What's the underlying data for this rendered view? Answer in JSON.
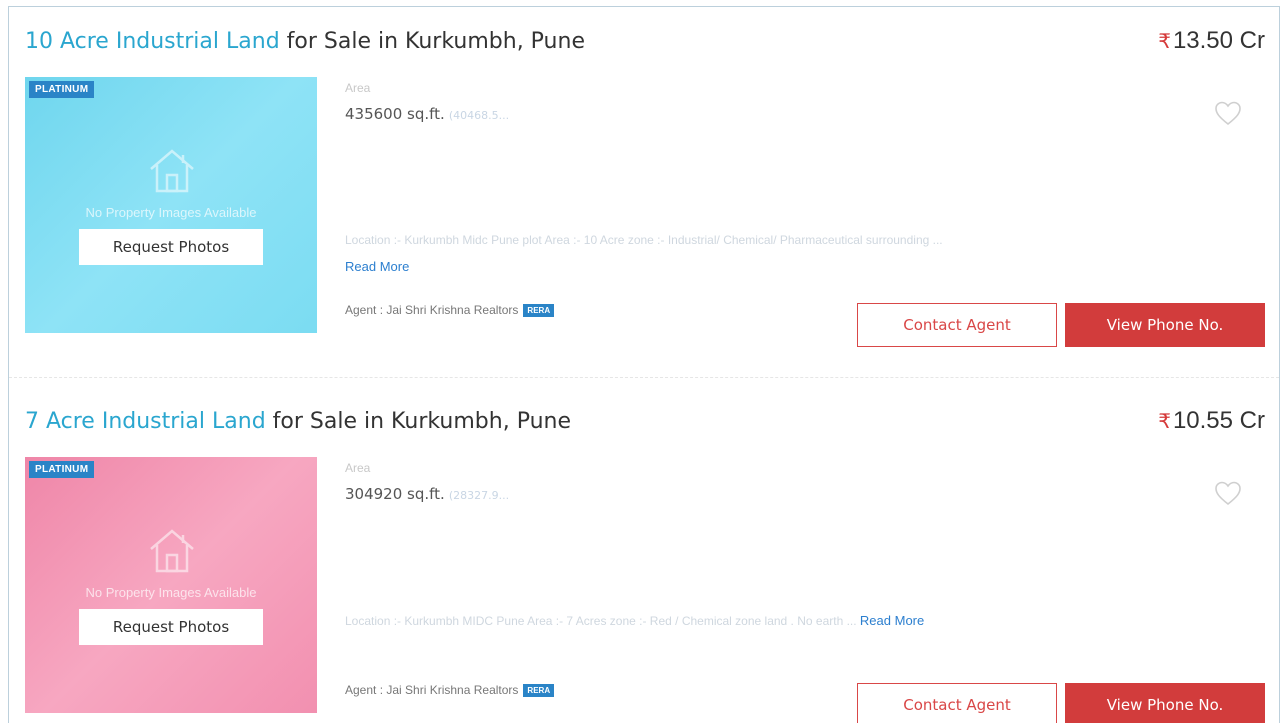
{
  "listings": [
    {
      "title_highlight": "10 Acre Industrial Land",
      "title_rest": " for Sale in Kurkumbh, Pune",
      "currency_symbol": "₹",
      "price": "13.50 Cr",
      "badge": "PLATINUM",
      "no_images_text": "No Property Images Available",
      "request_photos_label": "Request Photos",
      "area_label": "Area",
      "area_value": "435600 sq.ft.",
      "area_alt": "(40468.5...",
      "description": "Location :- Kurkumbh Midc Pune plot Area :- 10 Acre zone :- Industrial/ Chemical/ Pharmaceutical surrounding ...",
      "read_more_label": "Read More",
      "agent_text": "Agent : Jai Shri Krishna Realtors",
      "rera_badge": "RERA",
      "contact_label": "Contact Agent",
      "phone_label": "View Phone No.",
      "photo_color": "#7bdcf2"
    },
    {
      "title_highlight": "7 Acre Industrial Land",
      "title_rest": " for Sale in Kurkumbh, Pune",
      "currency_symbol": "₹",
      "price": "10.55 Cr",
      "badge": "PLATINUM",
      "no_images_text": "No Property Images Available",
      "request_photos_label": "Request Photos",
      "area_label": "Area",
      "area_value": "304920 sq.ft.",
      "area_alt": "(28327.9...",
      "description": "Location :- Kurkumbh MIDC Pune Area :- 7 Acres zone :- Red / Chemical zone land . No earth ...",
      "read_more_label": "Read More",
      "agent_text": "Agent : Jai Shri Krishna Realtors",
      "rera_badge": "RERA",
      "contact_label": "Contact Agent",
      "phone_label": "View Phone No.",
      "photo_color": "#f290b0"
    }
  ],
  "colors": {
    "title_highlight": "#2aa6cf",
    "rupee": "#d53a3a",
    "contact_border": "#d94747",
    "phone_bg": "#d23c3c",
    "badge_bg": "#2a84c7",
    "link": "#2c7fcf"
  },
  "icons": [
    "house-icon",
    "heart-icon"
  ]
}
